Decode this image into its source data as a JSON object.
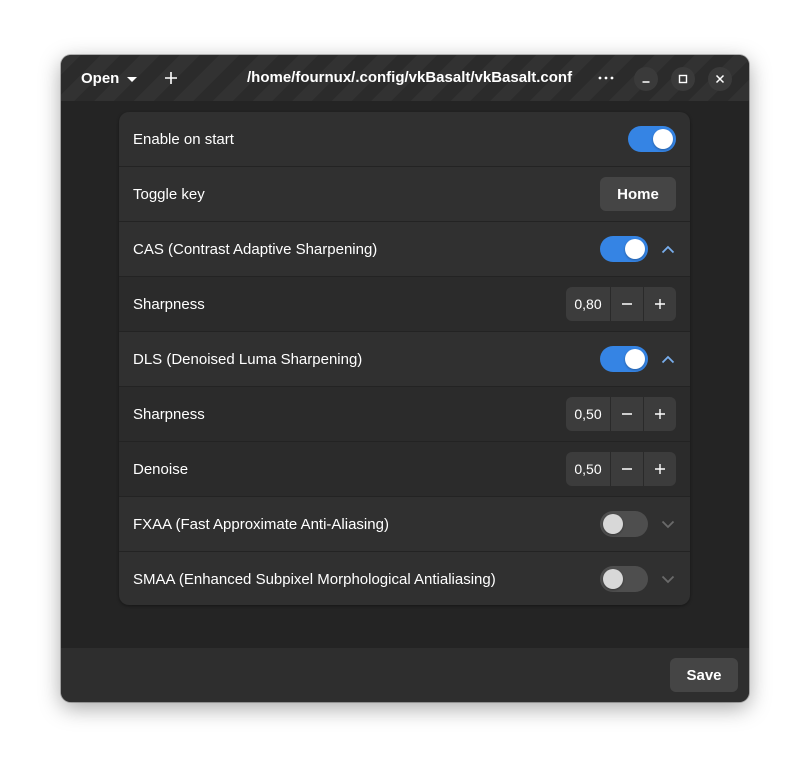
{
  "header": {
    "open_label": "Open",
    "title": "/home/fournux/.config/vkBasalt/vkBasalt.conf",
    "icons": {
      "open_dropdown": "caret-down-icon",
      "new_tab": "plus-icon",
      "menu": "more-horizontal-icon",
      "minimize": "minimize-icon",
      "maximize": "maximize-icon",
      "close": "close-icon"
    }
  },
  "settings": {
    "enable_on_start": {
      "label": "Enable on start",
      "enabled": true
    },
    "toggle_key": {
      "label": "Toggle key",
      "value": "Home"
    },
    "cas": {
      "label": "CAS (Contrast Adaptive Sharpening)",
      "enabled": true,
      "expanded": true,
      "sharpness": {
        "label": "Sharpness",
        "value": "0,80"
      }
    },
    "dls": {
      "label": "DLS (Denoised Luma Sharpening)",
      "enabled": true,
      "expanded": true,
      "sharpness": {
        "label": "Sharpness",
        "value": "0,50"
      },
      "denoise": {
        "label": "Denoise",
        "value": "0,50"
      }
    },
    "fxaa": {
      "label": "FXAA (Fast Approximate Anti-Aliasing)",
      "enabled": false,
      "expanded": false
    },
    "smaa": {
      "label": "SMAA (Enhanced Subpixel Morphological Antialiasing)",
      "enabled": false,
      "expanded": false
    }
  },
  "footer": {
    "save_label": "Save"
  },
  "colors": {
    "accent": "#3584e4",
    "window_bg": "#242424",
    "card_bg": "#303030",
    "button_bg": "#454545"
  }
}
